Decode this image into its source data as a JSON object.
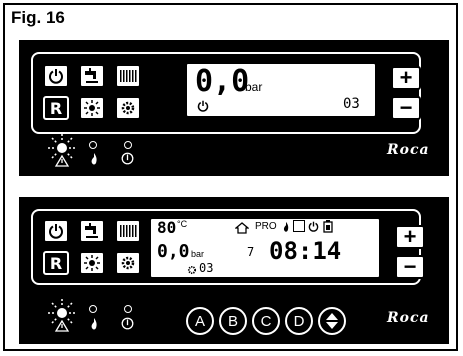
{
  "figure": {
    "title": "Fig. 16"
  },
  "panel1": {
    "display": {
      "pressure_value": "0,0",
      "pressure_unit": "bar",
      "code": "03"
    },
    "brand": "Roca"
  },
  "panel2": {
    "display": {
      "temperature_value": "80",
      "temperature_unit": "°C",
      "pressure_value": "0,0",
      "pressure_unit": "bar",
      "program_label": "PRO",
      "time": "08:14",
      "step": "7",
      "code": "03"
    },
    "buttons": [
      "A",
      "B",
      "C",
      "D"
    ],
    "brand": "Roca"
  },
  "keys": {
    "reset_label": "R"
  },
  "icons": {
    "power": "power-icon",
    "tap": "tap-icon",
    "radiator": "radiator-icon",
    "sun": "sun-icon",
    "gear": "gear-icon",
    "warning": "warning-icon",
    "flame": "flame-icon",
    "home": "home-icon",
    "battery": "battery-icon",
    "arrows": "up-down-arrows-icon"
  }
}
